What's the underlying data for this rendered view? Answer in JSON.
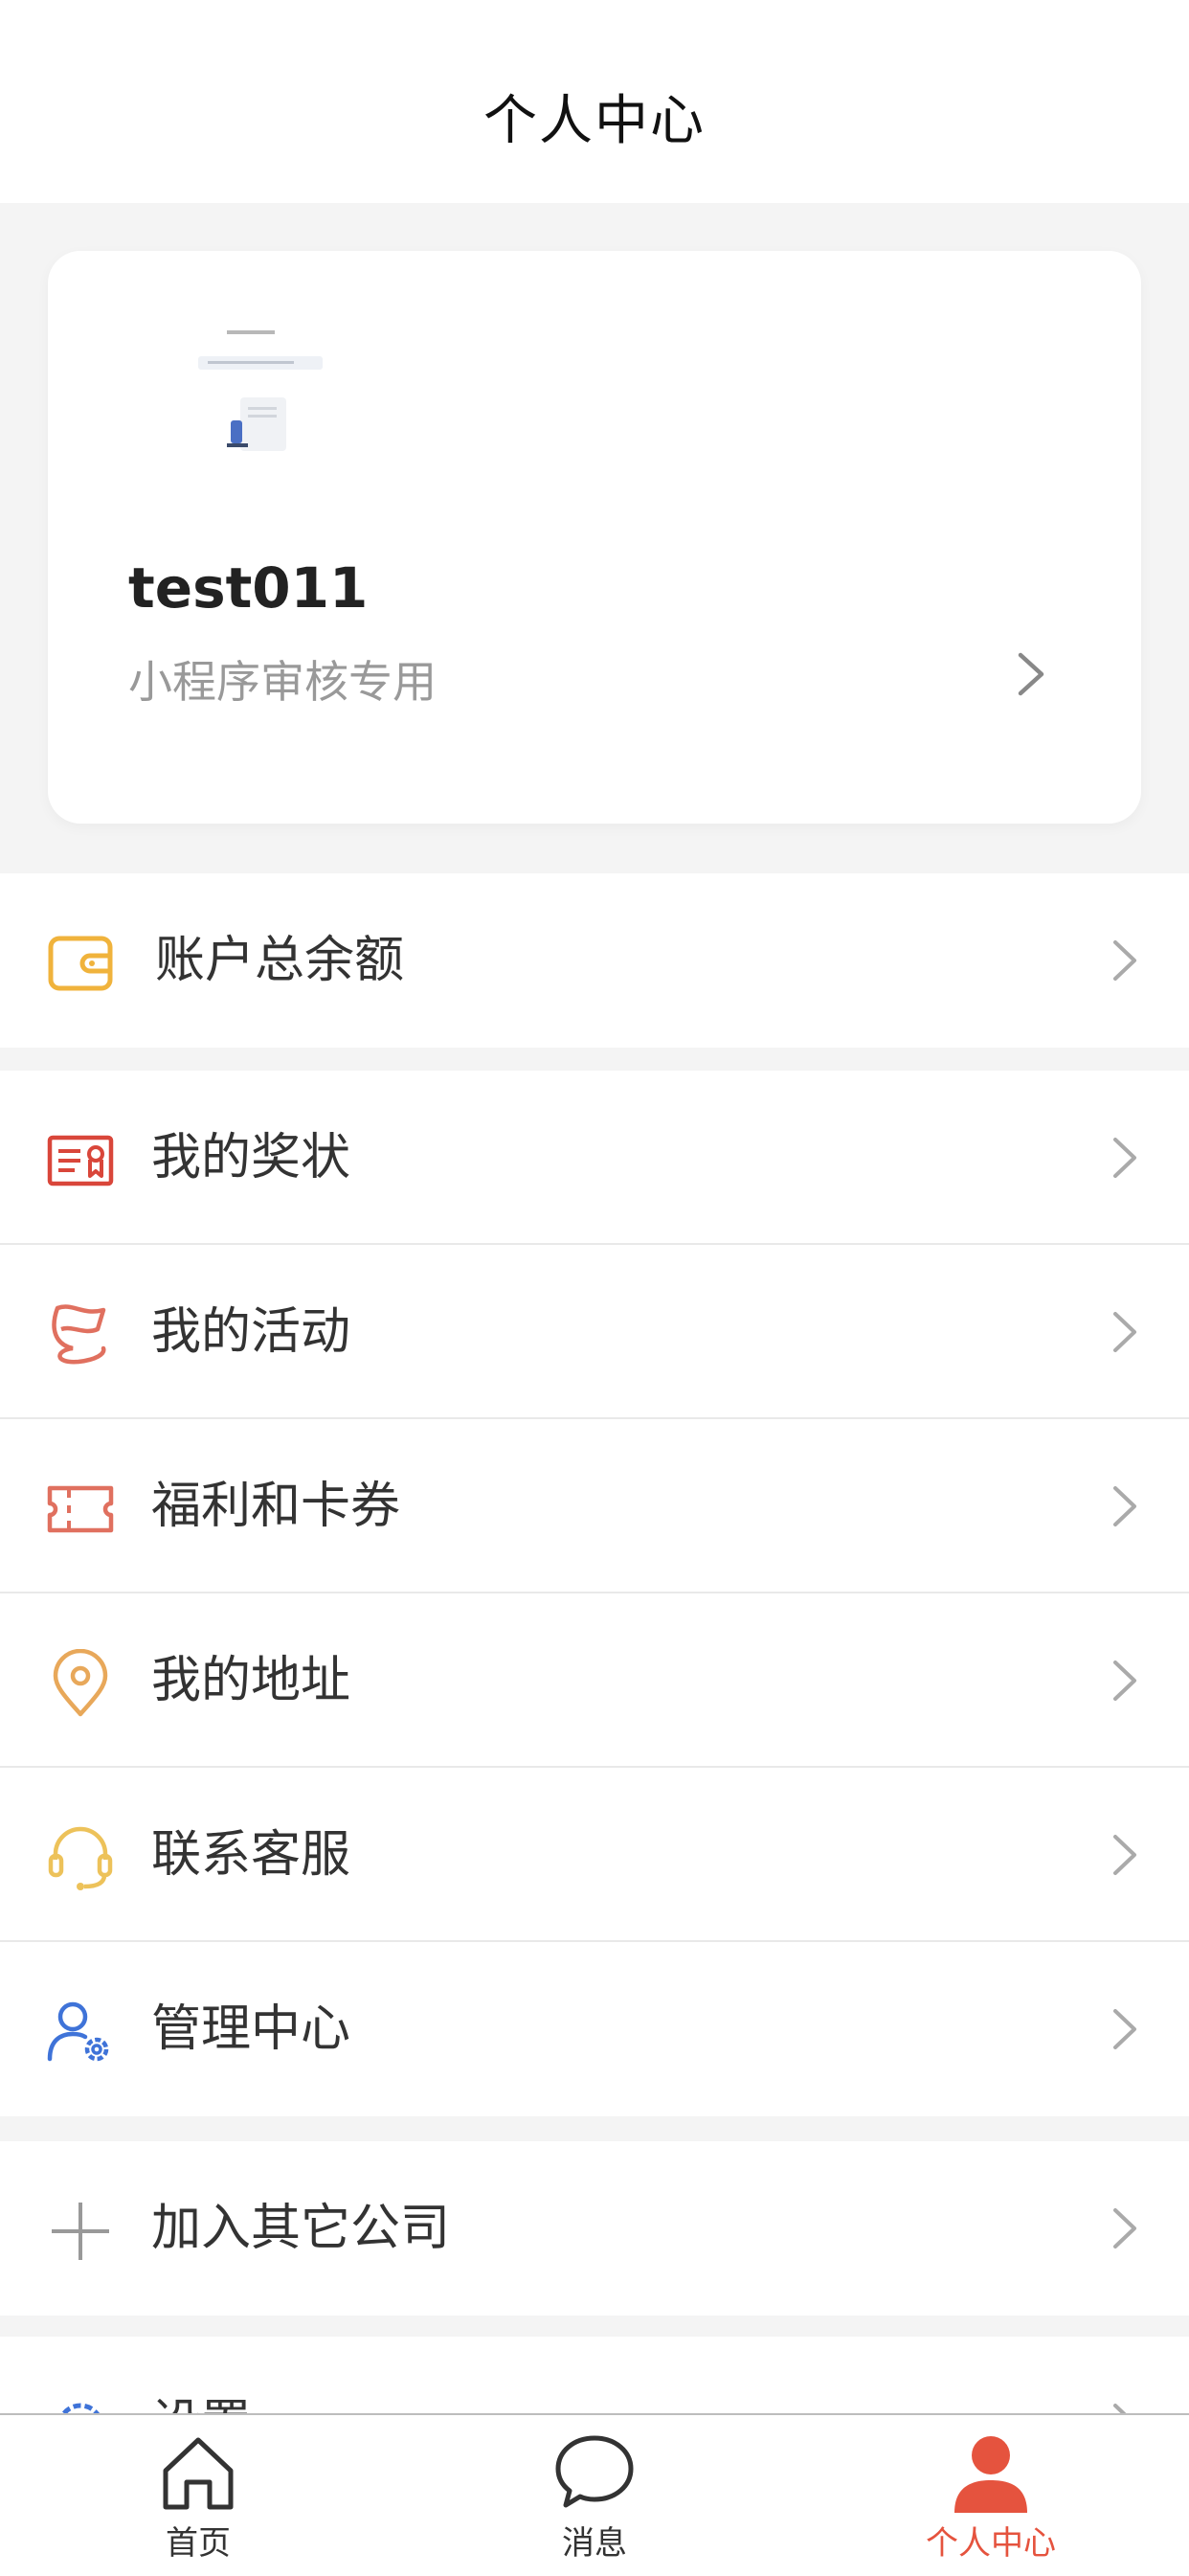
{
  "header": {
    "title": "个人中心"
  },
  "profile": {
    "name": "test011",
    "description": "小程序审核专用"
  },
  "menu_groups": [
    {
      "items": [
        {
          "label": "账户总余额",
          "icon": "wallet-icon"
        }
      ]
    },
    {
      "items": [
        {
          "label": "我的奖状",
          "icon": "certificate-icon"
        },
        {
          "label": "我的活动",
          "icon": "flag-icon"
        },
        {
          "label": "福利和卡券",
          "icon": "coupon-icon"
        },
        {
          "label": "我的地址",
          "icon": "location-pin-icon"
        },
        {
          "label": "联系客服",
          "icon": "headset-icon"
        },
        {
          "label": "管理中心",
          "icon": "user-gear-icon"
        }
      ]
    },
    {
      "items": [
        {
          "label": "加入其它公司",
          "icon": "plus-icon"
        }
      ]
    },
    {
      "items": [
        {
          "label": "设置",
          "icon": "gear-icon"
        }
      ]
    }
  ],
  "tab_bar": {
    "tabs": [
      {
        "label": "首页",
        "icon": "home-icon"
      },
      {
        "label": "消息",
        "icon": "chat-bubble-icon"
      },
      {
        "label": "个人中心",
        "icon": "person-icon"
      }
    ],
    "active_index": 2
  },
  "colors": {
    "accent": "#e5533e",
    "wallet": "#f0b33c",
    "certificate": "#d9463a",
    "flag": "#e0705f",
    "coupon": "#e0705f",
    "location": "#e8a85a",
    "headset": "#edc25a",
    "manage": "#3f73d8"
  }
}
